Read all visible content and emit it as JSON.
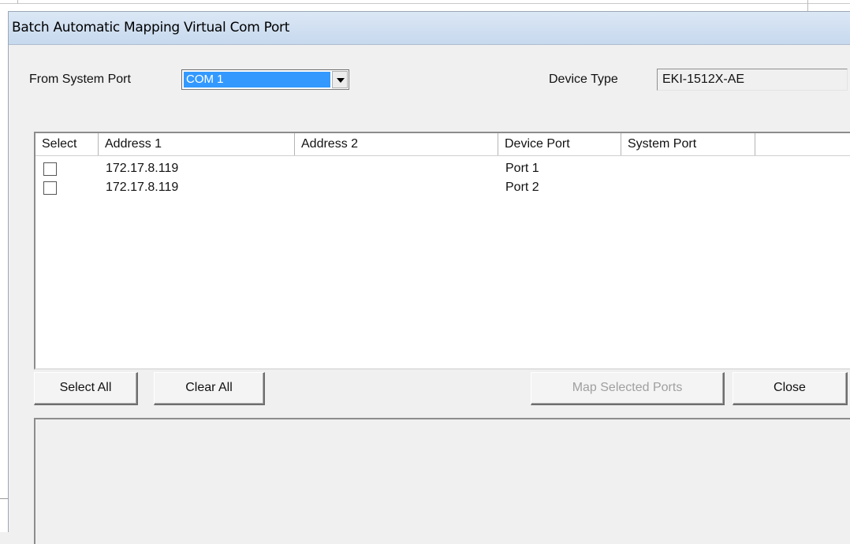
{
  "window": {
    "title": "Batch Automatic Mapping Virtual Com Port"
  },
  "form": {
    "from_system_port_label": "From System Port",
    "from_system_port_value": "COM 1",
    "device_type_label": "Device Type",
    "device_type_value": "EKI-1512X-AE"
  },
  "table": {
    "columns": [
      "Select",
      "Address 1",
      "Address 2",
      "Device Port",
      "System Port"
    ],
    "rows": [
      {
        "selected": false,
        "address1": "172.17.8.119",
        "address2": "",
        "device_port": "Port 1",
        "system_port": ""
      },
      {
        "selected": false,
        "address1": "172.17.8.119",
        "address2": "",
        "device_port": "Port 2",
        "system_port": ""
      }
    ]
  },
  "buttons": {
    "select_all": "Select All",
    "clear_all": "Clear All",
    "map_selected": "Map Selected Ports",
    "close": "Close"
  }
}
